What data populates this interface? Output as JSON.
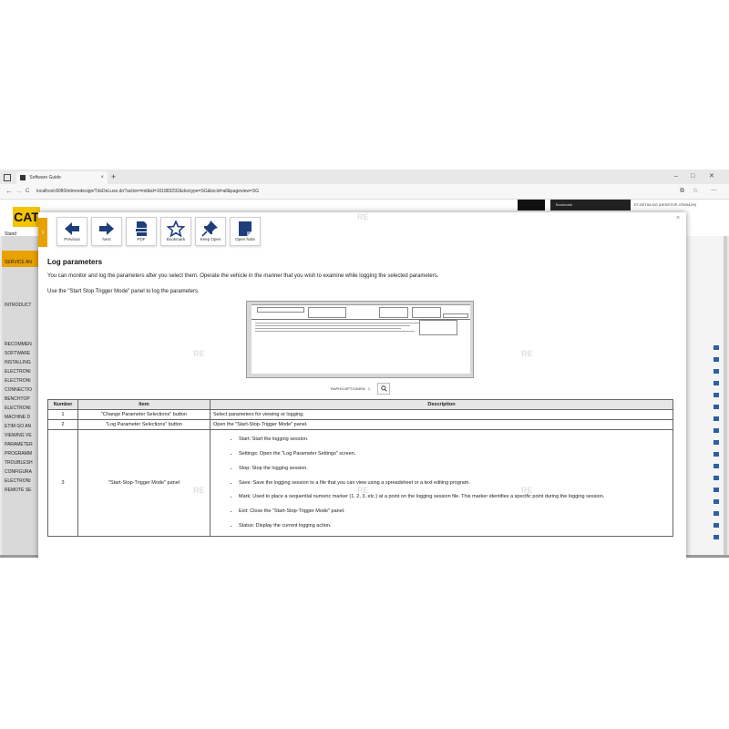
{
  "browser": {
    "tab_title": "Software Guide",
    "tab_close": "×",
    "new_tab": "+",
    "url": "localhost:8080/etimredesign/TdsDeLuxe.do?action=init&id=101883292&doctype=SG&tocid=all&pageview=SG",
    "nav_back": "←",
    "nav_forward": "→",
    "nav_reload": "C",
    "win_minimize": "–",
    "win_maximize": "□",
    "win_close": "✕",
    "star": "☆",
    "ext": "⧉",
    "more": "⋯"
  },
  "app": {
    "logo": "CAT",
    "bookmark_label": "Bookmark",
    "right_header": "ET-EETIM-DG (DESKTOP-4TMX42H)",
    "left_items": [
      "Stand",
      "SERVICE AN",
      "INTRODUCT",
      "RECOMMEN",
      "SOFTWARE",
      "INSTALLING",
      "ELECTRONI",
      "ELECTRONI",
      "CONNECTIO",
      "BENCHTOP",
      "ELECTRONI",
      "MACHINE D",
      "ETIM GO AN",
      "VIEWING VE",
      "PARAMETER",
      "PROGRAMM",
      "TROUBLESH",
      "CONFIGURA",
      "ELECTRONI",
      "REMOTE SE"
    ]
  },
  "modal": {
    "handle_icon": "›",
    "close": "×",
    "toolbar": [
      {
        "label": "Previous",
        "icon": "arrow-left"
      },
      {
        "label": "Next",
        "icon": "arrow-right"
      },
      {
        "label": "PDF",
        "icon": "pdf"
      },
      {
        "label": "Bookmark",
        "icon": "star"
      },
      {
        "label": "Keep Open",
        "icon": "pin"
      },
      {
        "label": "Open Note",
        "icon": "note"
      }
    ],
    "title": "Log parameters",
    "para1": "You can monitor and log the parameters after you select them. Operate the vehicle in the manner that you wish to examine while logging the selected parameters.",
    "para2": "Use the \"Start Stop Trigger Mode\" panel to log the parameters.",
    "figure_caption": "RAPH21SPT1004RA",
    "figure_page": "1",
    "zoom_icon": "search-plus",
    "table": {
      "headers": [
        "Number",
        "Item",
        "Description"
      ],
      "rows": [
        {
          "number": "1",
          "item": "\"Change Parameter Selections\" button",
          "description": "Select parameters for viewing or logging."
        },
        {
          "number": "2",
          "item": "\"Log Parameter Selections\" button",
          "description": "Open the \"Start-Stop-Trigger Mode\" panel."
        },
        {
          "number": "3",
          "item": "\"Start-Stop-Trigger Mode\" panel",
          "bullets": [
            "Start: Start the logging session.",
            "Settings: Open the \"Log Parameter Settings\" screen.",
            "Stop: Stop the logging session.",
            "Save: Save the logging session to a file that you can view using a spreadsheet or a text editing program.",
            "Mark: Used to place a sequential numeric marker (1, 2, 3, etc.) at a point on the logging session file. This marker identifies a specific point during the logging session.",
            "Exit: Close the \"Start-Stop-Trigger Mode\" panel.",
            "Status: Display the current logging action."
          ]
        }
      ]
    }
  },
  "watermark": "RE",
  "colors": {
    "accent": "#e8a200",
    "brand_yellow": "#f5c400",
    "flag_blue": "#2c5fa8"
  }
}
